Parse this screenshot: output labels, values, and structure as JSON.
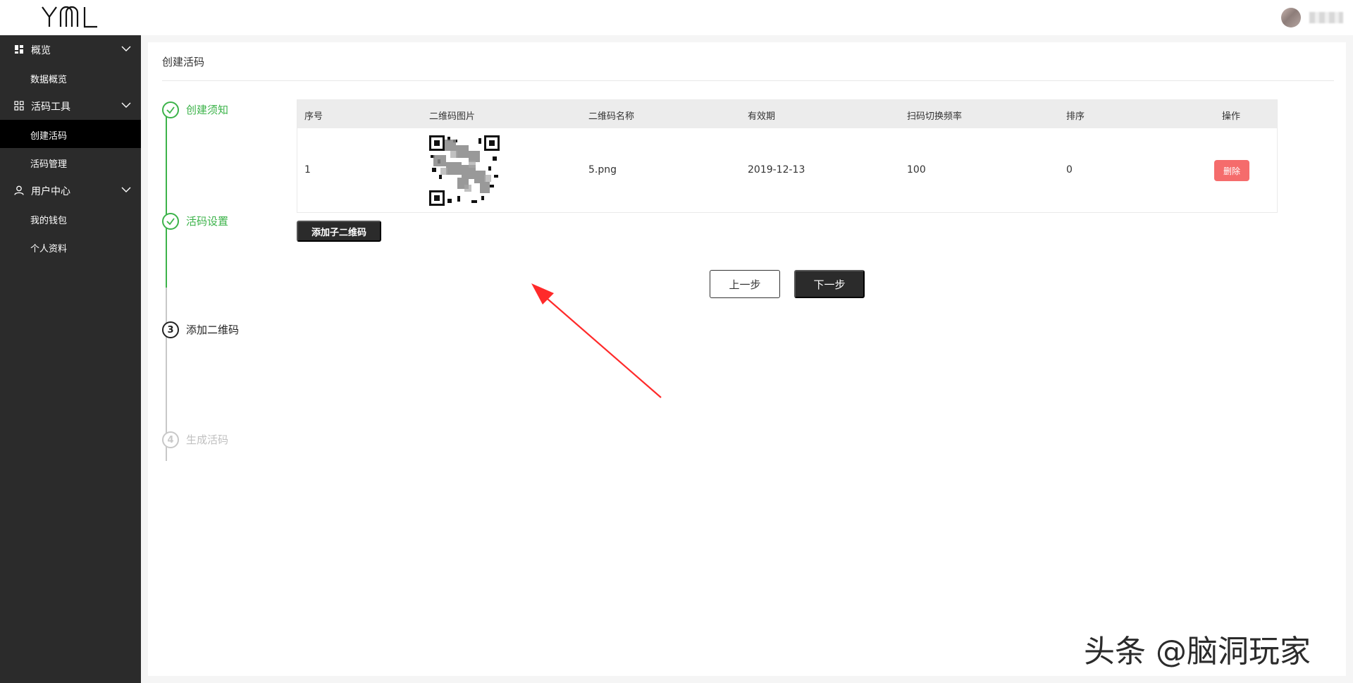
{
  "header": {
    "logo_text": "YML"
  },
  "sidebar": {
    "groups": [
      {
        "label": "概览",
        "items": [
          {
            "label": "数据概览"
          }
        ]
      },
      {
        "label": "活码工具",
        "items": [
          {
            "label": "创建活码",
            "active": true
          },
          {
            "label": "活码管理"
          }
        ]
      },
      {
        "label": "用户中心",
        "items": [
          {
            "label": "我的钱包"
          },
          {
            "label": "个人资料"
          }
        ]
      }
    ]
  },
  "main": {
    "title": "创建活码",
    "steps": [
      {
        "label": "创建须知",
        "status": "done"
      },
      {
        "label": "活码设置",
        "status": "done"
      },
      {
        "number": "3",
        "label": "添加二维码",
        "status": "current"
      },
      {
        "number": "4",
        "label": "生成活码",
        "status": "todo"
      }
    ],
    "table": {
      "columns": [
        "序号",
        "二维码图片",
        "二维码名称",
        "有效期",
        "扫码切换频率",
        "排序",
        "操作"
      ],
      "rows": [
        {
          "index": "1",
          "name": "5.png",
          "expiry": "2019-12-13",
          "switch_rate": "100",
          "order": "0",
          "action": "删除"
        }
      ]
    },
    "add_button": "添加子二维码",
    "prev_button": "上一步",
    "next_button": "下一步"
  },
  "watermark": "头条 @脑洞玩家",
  "colors": {
    "sidebar_bg": "#2b2b2b",
    "success_green": "#3cb34a",
    "danger_red": "#f56c6c",
    "annotation_arrow": "#ff2a2a"
  }
}
